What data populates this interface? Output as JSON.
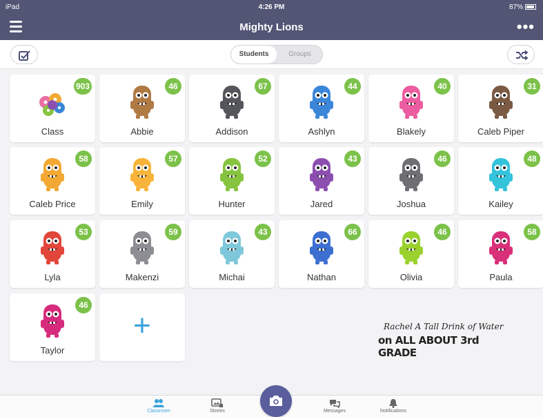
{
  "status_bar": {
    "device": "iPad",
    "time": "4:26 PM",
    "battery": "87%"
  },
  "header": {
    "title": "Mighty Lions"
  },
  "segments": {
    "students": "Students",
    "groups": "Groups"
  },
  "colors": {
    "header": "#525574",
    "badge": "#7cc24a",
    "accent": "#39a3dc",
    "camera": "#5a5e9d"
  },
  "students": [
    {
      "name": "Class",
      "points": "903",
      "avatar": "class-group",
      "color": "#e96fa3"
    },
    {
      "name": "Abbie",
      "points": "46",
      "avatar": "monster",
      "color": "#b07a45"
    },
    {
      "name": "Addison",
      "points": "67",
      "avatar": "monster",
      "color": "#55565c"
    },
    {
      "name": "Ashlyn",
      "points": "44",
      "avatar": "monster",
      "color": "#3b86d9"
    },
    {
      "name": "Blakely",
      "points": "40",
      "avatar": "monster",
      "color": "#ec5ca0"
    },
    {
      "name": "Caleb Piper",
      "points": "31",
      "avatar": "monster",
      "color": "#7b5a44"
    },
    {
      "name": "Caleb Price",
      "points": "58",
      "avatar": "monster",
      "color": "#f2a833"
    },
    {
      "name": "Emily",
      "points": "57",
      "avatar": "monster",
      "color": "#f8b43a"
    },
    {
      "name": "Hunter",
      "points": "52",
      "avatar": "monster",
      "color": "#86c43f"
    },
    {
      "name": "Jared",
      "points": "43",
      "avatar": "monster",
      "color": "#8c4fb0"
    },
    {
      "name": "Joshua",
      "points": "46",
      "avatar": "monster",
      "color": "#6e6e73"
    },
    {
      "name": "Kailey",
      "points": "48",
      "avatar": "monster",
      "color": "#33c3db"
    },
    {
      "name": "Lyla",
      "points": "53",
      "avatar": "monster",
      "color": "#e2463a"
    },
    {
      "name": "Makenzi",
      "points": "59",
      "avatar": "monster",
      "color": "#8d8d94"
    },
    {
      "name": "Michai",
      "points": "43",
      "avatar": "monster",
      "color": "#7fc8db"
    },
    {
      "name": "Nathan",
      "points": "66",
      "avatar": "monster",
      "color": "#3d6fd1"
    },
    {
      "name": "Olivia",
      "points": "46",
      "avatar": "monster",
      "color": "#9ad12f"
    },
    {
      "name": "Paula",
      "points": "58",
      "avatar": "monster",
      "color": "#d9307a"
    },
    {
      "name": "Taylor",
      "points": "46",
      "avatar": "monster",
      "color": "#d62b7c"
    }
  ],
  "add_card": {
    "symbol": "+"
  },
  "watermark": {
    "line1": "Rachel A Tall Drink of Water",
    "line2": "on ALL ABOUT 3rd GRADE"
  },
  "tabs": [
    {
      "label": "Classroom",
      "icon": "classroom-icon",
      "active": true
    },
    {
      "label": "Stories",
      "icon": "stories-icon",
      "active": false
    },
    {
      "label": "Messages",
      "icon": "messages-icon",
      "active": false
    },
    {
      "label": "Notifications",
      "icon": "notifications-icon",
      "active": false
    }
  ],
  "camera": {
    "icon": "camera-icon"
  }
}
